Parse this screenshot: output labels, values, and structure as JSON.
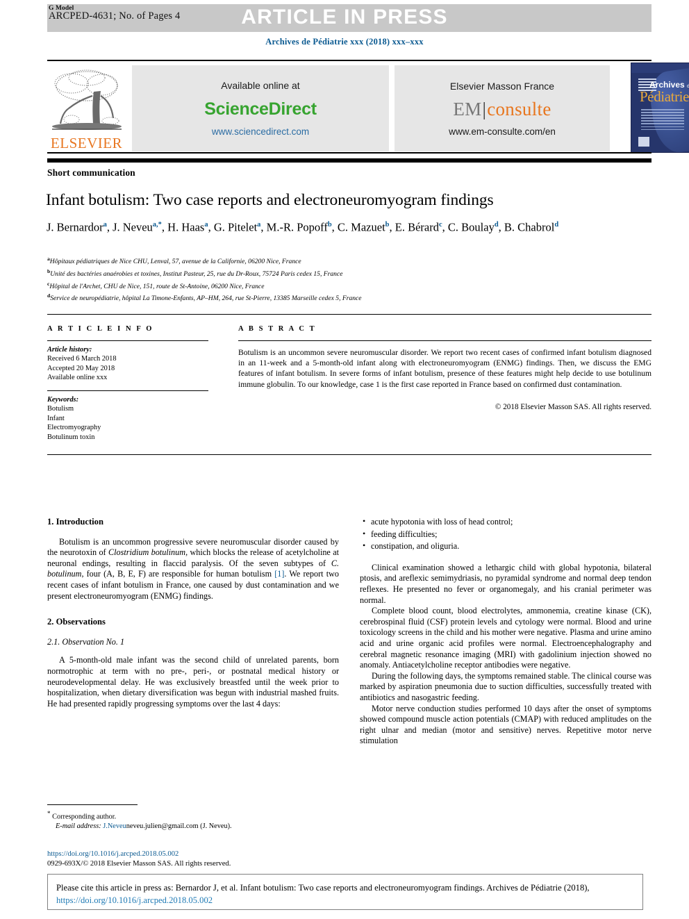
{
  "header": {
    "g_model_label": "G Model",
    "article_code": "ARCPED-4631; No. of Pages 4",
    "article_in_press": "ARTICLE IN PRESS",
    "journal_line": "Archives de Pédiatrie xxx (2018) xxx–xxx"
  },
  "masthead": {
    "elsevier_wordmark": "ELSEVIER",
    "sciencedirect": {
      "available_online": "Available online at",
      "brand": "ScienceDirect",
      "url": "www.sciencedirect.com"
    },
    "emconsulte": {
      "publisher": "Elsevier Masson France",
      "brand_left": "EM",
      "brand_right": "consulte",
      "url": "www.em-consulte.com/en"
    },
    "cover": {
      "archives": "Archives",
      "de": "de",
      "pediatrie": "Pédiatrie"
    }
  },
  "article": {
    "section_type": "Short communication",
    "title": "Infant botulism: Two case reports and electroneuromyogram findings",
    "authors": [
      {
        "name": "J. Bernardor",
        "sup": "a",
        "star": false
      },
      {
        "name": "J. Neveu",
        "sup": "a,",
        "star": true
      },
      {
        "name": "H. Haas",
        "sup": "a",
        "star": false
      },
      {
        "name": "G. Pitelet",
        "sup": "a",
        "star": false
      },
      {
        "name": "M.-R. Popoff",
        "sup": "b",
        "star": false
      },
      {
        "name": "C. Mazuet",
        "sup": "b",
        "star": false
      },
      {
        "name": "E. Bérard",
        "sup": "c",
        "star": false
      },
      {
        "name": "C. Boulay",
        "sup": "d",
        "star": false
      },
      {
        "name": "B. Chabrol",
        "sup": "d",
        "star": false
      }
    ],
    "affiliations": [
      {
        "mark": "a",
        "text": "Hôpitaux pédiatriques de Nice CHU, Lenval, 57, avenue de la Californie, 06200 Nice, France"
      },
      {
        "mark": "b",
        "text": "Unité des bactéries anaérobies et toxines, Institut Pasteur, 25, rue du Dr-Roux, 75724 Paris cedex 15, France"
      },
      {
        "mark": "c",
        "text": "Hôpital de l'Archet, CHU de Nice, 151, route de St-Antoine, 06200 Nice, France"
      },
      {
        "mark": "d",
        "text": "Service de neuropédiatrie, hôpital La Timone-Enfants, AP–HM, 264, rue St-Pierre, 13385 Marseille cedex 5, France"
      }
    ]
  },
  "article_info": {
    "heading": "A R T I C L E  I N F O",
    "history_label": "Article history:",
    "history": [
      "Received 6 March 2018",
      "Accepted 20 May 2018",
      "Available online xxx"
    ],
    "keywords_label": "Keywords:",
    "keywords": [
      "Botulism",
      "Infant",
      "Electromyography",
      "Botulinum toxin"
    ]
  },
  "abstract": {
    "heading": "A B S T R A C T",
    "text": "Botulism is an uncommon severe neuromuscular disorder. We report two recent cases of confirmed infant botulism diagnosed in an 11-week and a 5-month-old infant along with electroneuromyogram (ENMG) findings. Then, we discuss the EMG features of infant botulism. In severe forms of infant botulism, presence of these features might help decide to use botulinum immune globulin. To our knowledge, case 1 is the first case reported in France based on confirmed dust contamination.",
    "copyright": "© 2018 Elsevier Masson SAS. All rights reserved."
  },
  "body": {
    "intro_heading": "1. Introduction",
    "intro_p1_a": "Botulism is an uncommon progressive severe neuromuscular disorder caused by the neurotoxin of ",
    "intro_p1_italic1": "Clostridium botulinum",
    "intro_p1_b": ", which blocks the release of acetylcholine at neuronal endings, resulting in flaccid paralysis. Of the seven subtypes of ",
    "intro_p1_italic2": "C. botulinum",
    "intro_p1_c": ", four (A, B, E, F) are responsible for human botulism ",
    "intro_p1_ref": "[1]",
    "intro_p1_d": ". We report two recent cases of infant botulism in France, one caused by dust contamination and we present electroneuromyogram (ENMG) findings.",
    "obs_heading": "2. Observations",
    "obs1_heading": "2.1. Observation No. 1",
    "obs1_p1": "A 5-month-old male infant was the second child of unrelated parents, born normotrophic at term with no pre-, peri-, or postnatal medical history or neurodevelopmental delay. He was exclusively breastfed until the week prior to hospitalization, when dietary diversification was begun with industrial mashed fruits. He had presented rapidly progressing symptoms over the last 4 days:",
    "symptoms": [
      "acute hypotonia with loss of head control;",
      "feeding difficulties;",
      "constipation, and oliguria."
    ],
    "right_p1": "Clinical examination showed a lethargic child with global hypotonia, bilateral ptosis, and areflexic semimydriasis, no pyramidal syndrome and normal deep tendon reflexes. He presented no fever or organomegaly, and his cranial perimeter was normal.",
    "right_p2": "Complete blood count, blood electrolytes, ammonemia, creatine kinase (CK), cerebrospinal fluid (CSF) protein levels and cytology were normal. Blood and urine toxicology screens in the child and his mother were negative. Plasma and urine amino acid and urine organic acid profiles were normal. Electroencephalography and cerebral magnetic resonance imaging (MRI) with gadolinium injection showed no anomaly. Antiacetylcholine receptor antibodies were negative.",
    "right_p3": "During the following days, the symptoms remained stable. The clinical course was marked by aspiration pneumonia due to suction difficulties, successfully treated with antibiotics and nasogastric feeding.",
    "right_p4": "Motor nerve conduction studies performed 10 days after the onset of symptoms showed compound muscle action potentials (CMAP) with reduced amplitudes on the right ulnar and median (motor and sensitive) nerves. Repetitive motor nerve stimulation"
  },
  "footnote": {
    "star": "*",
    "corresponding": "Corresponding author.",
    "email_label": "E-mail address:",
    "email_link": "J.Neveu",
    "email_rest": "neveu.julien@gmail.com (J. Neveu).",
    "doi": "https://doi.org/10.1016/j.arcped.2018.05.002",
    "issn_line": "0929-693X/© 2018 Elsevier Masson SAS. All rights reserved."
  },
  "cite_box": {
    "text_a": "Please cite this article in press as: Bernardor J, et al. Infant botulism: Two case reports and electroneuromyogram findings. Archives de Pédiatrie (2018), ",
    "doi": "https://doi.org/10.1016/j.arcped.2018.05.002"
  },
  "colors": {
    "link_blue": "#0b5a91",
    "sciencedirect_green": "#37A430",
    "elsevier_orange": "#E87722",
    "consulte_orange": "#E8761E",
    "banner_gray": "#c8c8c8",
    "box_gray": "#e6e6e6"
  }
}
